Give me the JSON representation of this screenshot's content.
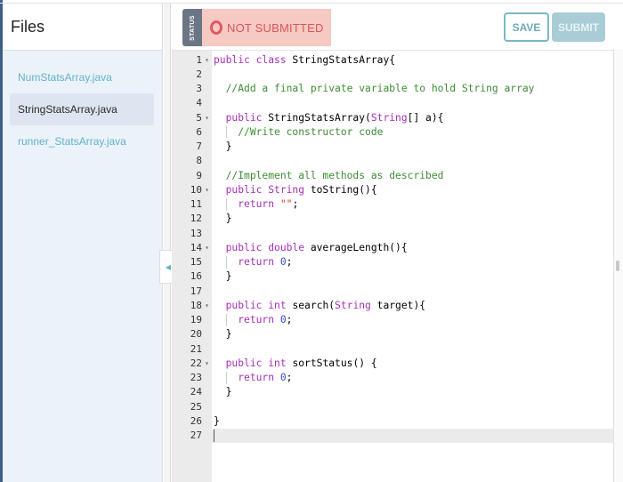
{
  "sidebar": {
    "title": "Files",
    "files": [
      {
        "name": "NumStatsArray.java",
        "active": false
      },
      {
        "name": "StringStatsArray.java",
        "active": true
      },
      {
        "name": "runner_StatsArray.java",
        "active": false
      }
    ],
    "collapse_icon": "chevron-left-icon"
  },
  "toolbar": {
    "status_tag": "STATUS",
    "status_text": "NOT SUBMITTED",
    "status_icon": "circle-outline-icon",
    "save_label": "SAVE",
    "submit_label": "SUBMIT"
  },
  "colors": {
    "accent": "#5fb3c7",
    "status_bg": "#f6c9c3",
    "status_fg": "#d9555d",
    "keyword": "#a52fb6",
    "comment": "#3d8c33",
    "number": "#3949c9"
  },
  "editor": {
    "active_line": 27,
    "lines": [
      {
        "n": "1",
        "fold": true,
        "tokens": [
          [
            "kw",
            "public class "
          ],
          [
            "",
            "StringStatsArray{"
          ]
        ]
      },
      {
        "n": "2",
        "fold": false,
        "tokens": []
      },
      {
        "n": "3",
        "fold": false,
        "tokens": [
          [
            "",
            "  "
          ],
          [
            "cm",
            "//Add a final private variable to hold String array"
          ]
        ]
      },
      {
        "n": "4",
        "fold": false,
        "tokens": []
      },
      {
        "n": "5",
        "fold": true,
        "tokens": [
          [
            "",
            "  "
          ],
          [
            "kw",
            "public "
          ],
          [
            "",
            "StringStatsArray("
          ],
          [
            "kw",
            "String"
          ],
          [
            "",
            "[] a){"
          ]
        ]
      },
      {
        "n": "6",
        "fold": false,
        "tokens": [
          [
            "",
            "    "
          ],
          [
            "cm",
            "//Write constructor code"
          ]
        ]
      },
      {
        "n": "7",
        "fold": false,
        "tokens": [
          [
            "",
            "  }"
          ]
        ]
      },
      {
        "n": "8",
        "fold": false,
        "tokens": []
      },
      {
        "n": "9",
        "fold": false,
        "tokens": [
          [
            "",
            "  "
          ],
          [
            "cm",
            "//Implement all methods as described"
          ]
        ]
      },
      {
        "n": "10",
        "fold": true,
        "tokens": [
          [
            "",
            "  "
          ],
          [
            "kw",
            "public String "
          ],
          [
            "",
            "toString(){"
          ]
        ]
      },
      {
        "n": "11",
        "fold": false,
        "tokens": [
          [
            "",
            "    "
          ],
          [
            "kw",
            "return "
          ],
          [
            "str",
            "\"\""
          ],
          [
            "",
            ";"
          ]
        ]
      },
      {
        "n": "12",
        "fold": false,
        "tokens": [
          [
            "",
            "  }"
          ]
        ]
      },
      {
        "n": "13",
        "fold": false,
        "tokens": []
      },
      {
        "n": "14",
        "fold": true,
        "tokens": [
          [
            "",
            "  "
          ],
          [
            "kw",
            "public double "
          ],
          [
            "",
            "averageLength(){"
          ]
        ]
      },
      {
        "n": "15",
        "fold": false,
        "tokens": [
          [
            "",
            "    "
          ],
          [
            "kw",
            "return "
          ],
          [
            "num",
            "0"
          ],
          [
            "",
            ";"
          ]
        ]
      },
      {
        "n": "16",
        "fold": false,
        "tokens": [
          [
            "",
            "  }"
          ]
        ]
      },
      {
        "n": "17",
        "fold": false,
        "tokens": []
      },
      {
        "n": "18",
        "fold": true,
        "tokens": [
          [
            "",
            "  "
          ],
          [
            "kw",
            "public int "
          ],
          [
            "",
            "search("
          ],
          [
            "kw",
            "String "
          ],
          [
            "",
            "target){"
          ]
        ]
      },
      {
        "n": "19",
        "fold": false,
        "tokens": [
          [
            "",
            "    "
          ],
          [
            "kw",
            "return "
          ],
          [
            "num",
            "0"
          ],
          [
            "",
            ";"
          ]
        ]
      },
      {
        "n": "20",
        "fold": false,
        "tokens": [
          [
            "",
            "  }"
          ]
        ]
      },
      {
        "n": "21",
        "fold": false,
        "tokens": []
      },
      {
        "n": "22",
        "fold": true,
        "tokens": [
          [
            "",
            "  "
          ],
          [
            "kw",
            "public int "
          ],
          [
            "",
            "sortStatus() {"
          ]
        ]
      },
      {
        "n": "23",
        "fold": false,
        "tokens": [
          [
            "",
            "    "
          ],
          [
            "kw",
            "return "
          ],
          [
            "num",
            "0"
          ],
          [
            "",
            ";"
          ]
        ]
      },
      {
        "n": "24",
        "fold": false,
        "tokens": [
          [
            "",
            "  }"
          ]
        ]
      },
      {
        "n": "25",
        "fold": false,
        "tokens": []
      },
      {
        "n": "26",
        "fold": false,
        "tokens": [
          [
            "",
            "}"
          ]
        ]
      },
      {
        "n": "27",
        "fold": false,
        "tokens": []
      }
    ]
  }
}
